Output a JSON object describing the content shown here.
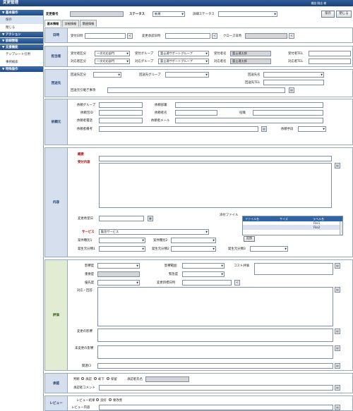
{
  "app": {
    "title": "変更管理",
    "user": "橋詰 剛志 様"
  },
  "sidebar": {
    "sections": [
      {
        "label": "▼ 基本操作",
        "items": [
          "保存",
          "閉じる"
        ]
      },
      {
        "label": "▼ アクション",
        "items": []
      },
      {
        "label": "▼ 詳細情報",
        "items": []
      },
      {
        "label": "▼ 支援機能",
        "items": [
          "テンプレート引用",
          "事例検索"
        ]
      },
      {
        "label": "▼ 特殊操作",
        "items": []
      }
    ]
  },
  "header": {
    "number_label": "変更番号",
    "status_label": "ステータス",
    "status_value": "新規",
    "detail_status_label": "詳細ステータス",
    "detail_status_value": "",
    "save_label": "保存",
    "close_label": "閉じる"
  },
  "tabs": [
    "基本情報",
    "詳細情報",
    "関連情報"
  ],
  "sections": {
    "date": {
      "title": "日時",
      "accept_label": "受付日時",
      "approve_label": "変更承認日時",
      "close_label": "クローズ日時"
    },
    "owner": {
      "title": "担当者",
      "accept_div_label": "受付者区分",
      "accept_div_value": "一次対応部門",
      "accept_group_label": "受付グループ",
      "accept_group_value": "富士通サポートグループ",
      "accept_name_label": "受付者名",
      "accept_name_value": "富士通太郎",
      "accept_tel_label": "受付者TEL",
      "resp_div_label": "対応者区分",
      "resp_div_value": "一次対応部門",
      "resp_group_label": "対応グループ",
      "resp_group_value": "富士通サポートグループ",
      "resp_name_label": "対応者名",
      "resp_name_value": "富士通太郎",
      "resp_tel_label": "対応者TEL"
    },
    "escalation": {
      "title": "回送先",
      "div_label": "回送先区分",
      "group_label": "回送先グループ",
      "name_label": "回送先名",
      "tel_label": "回送先TEL",
      "handover_label": "回送元引継ぎ事項"
    },
    "requester": {
      "title": "依頼元",
      "group_label": "依頼グループ",
      "dept_label": "依頼部署",
      "id_label": "依頼元ID",
      "name_label": "依頼者名",
      "title2_label": "役職",
      "phone_label": "依頼者電話",
      "mail_label": "依頼者メール",
      "note_label": "依頼者備考",
      "method_label": "依頼手段"
    },
    "content": {
      "title": "内容",
      "summary_label": "概要",
      "detail_label": "受付内容",
      "desired_date_label": "変更希望日",
      "attach_label": "添付ファイル",
      "attach_cols": [
        "ファイル名",
        "サイズ",
        "ラベル名"
      ],
      "attach_rows": [
        "File1",
        "File2"
      ],
      "add_label": "追加",
      "service_label": "サービス",
      "service_value": "勤怠サービス",
      "case_type1_label": "案件種別1",
      "case_type2_label": "案件種別2",
      "origin1_label": "発生元分類1",
      "origin2_label": "発生元分類2",
      "origin3_label": "発生元分類3"
    },
    "evaluation": {
      "title": "評価",
      "impact_label": "影響度",
      "scope_label": "影響範囲",
      "cost_label": "コスト評価",
      "importance_label": "重要度",
      "urgency_label": "緊急度",
      "priority_label": "優先度",
      "target_date_label": "変更目標日時",
      "response_label": "対応・回答",
      "impact_of_change_label": "変更の影響",
      "impact_no_change_label": "未変更の影響",
      "related_ci_label": "関連CI"
    },
    "approval": {
      "title": "承認",
      "judge_label": "判断",
      "options": [
        "承認",
        "却下",
        "保留"
      ],
      "approver_label": "承認者氏名",
      "comment_label": "承認者コメント"
    },
    "review": {
      "title": "レビュー",
      "result_label": "レビュー結果",
      "options": [
        "良好",
        "要改善"
      ],
      "content_label": "レビュー内容"
    }
  }
}
